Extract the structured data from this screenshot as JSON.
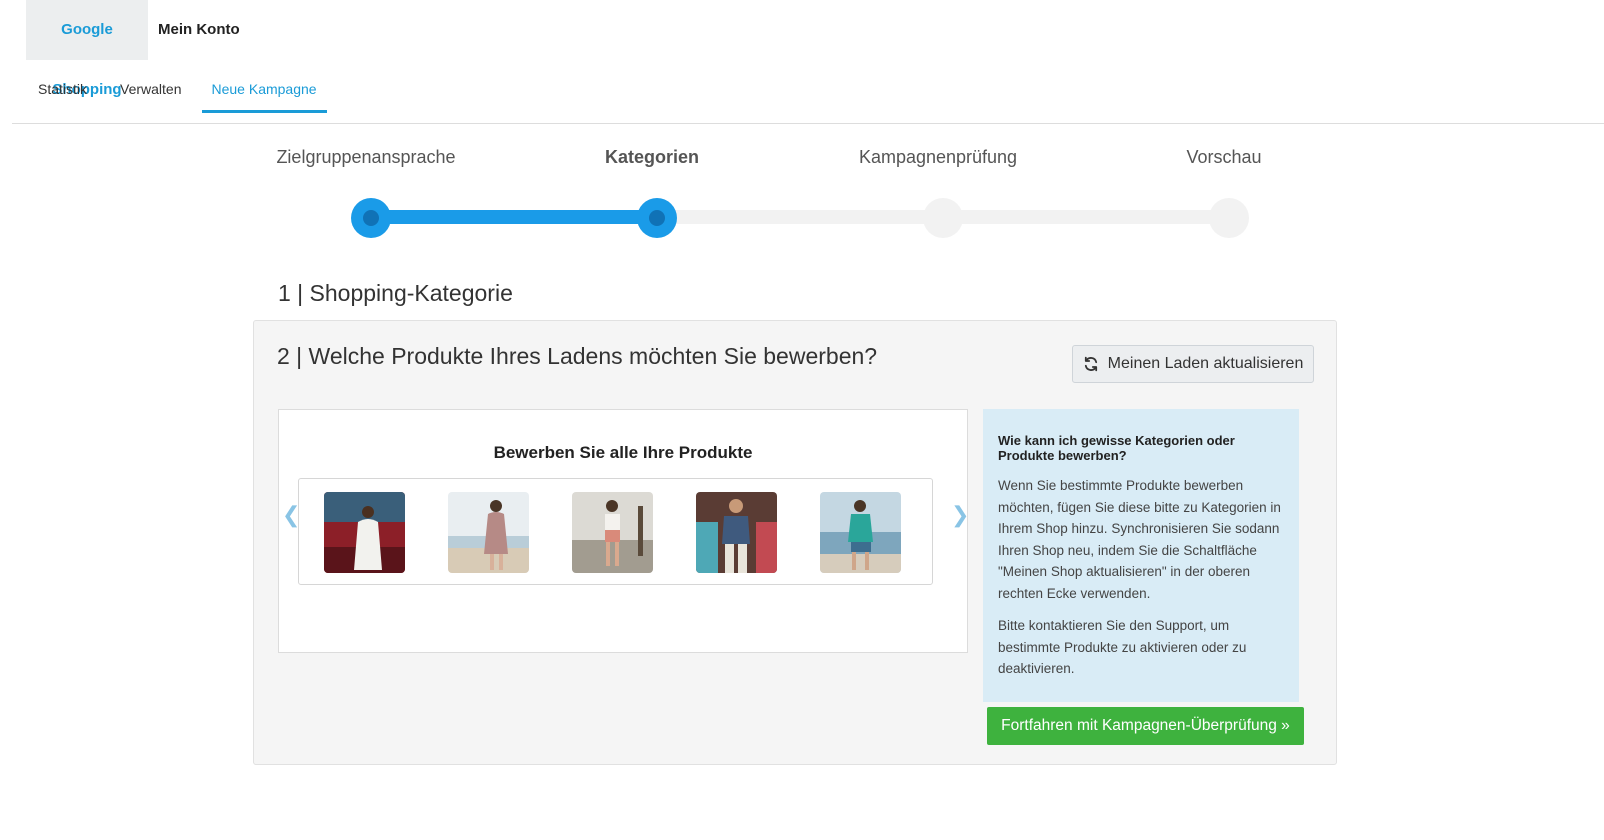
{
  "top_tabs": {
    "google_shopping": "Google Shopping",
    "mein_konto": "Mein Konto"
  },
  "sub_nav": {
    "statistik": "Statistik",
    "verwalten": "Verwalten",
    "neue_kampagne": "Neue Kampagne"
  },
  "stepper": {
    "steps": [
      "Zielgruppenansprache",
      "Kategorien",
      "Kampagnenprüfung",
      "Vorschau"
    ],
    "current_step": 2
  },
  "section1": {
    "title": "1 | Shopping-Kategorie"
  },
  "section2": {
    "title": "2 | Welche Produkte Ihres Ladens möchten Sie bewerben?",
    "refresh_button": "Meinen Laden aktualisieren"
  },
  "products": {
    "title": "Bewerben Sie alle Ihre Produkte",
    "prev_arrow": "❮",
    "next_arrow": "❯"
  },
  "info": {
    "title": "Wie kann ich gewisse Kategorien oder Produkte bewerben?",
    "paragraph1": "Wenn Sie bestimmte Produkte bewerben möchten, fügen Sie diese bitte zu Kategorien in Ihrem Shop hinzu. Synchronisieren Sie sodann Ihren Shop neu, indem Sie die Schaltfläche \"Meinen Shop aktualisieren\" in der oberen rechten Ecke verwenden.",
    "paragraph2": "Bitte kontaktieren Sie den Support, um bestimmte Produkte zu aktivieren oder zu deaktivieren."
  },
  "continue_button": "Fortfahren mit Kampagnen-Überprüfung »",
  "colors": {
    "accent": "#1a9be8",
    "link": "#1a9bd7",
    "success": "#3eb23e",
    "info_bg": "#d9ecf6"
  }
}
